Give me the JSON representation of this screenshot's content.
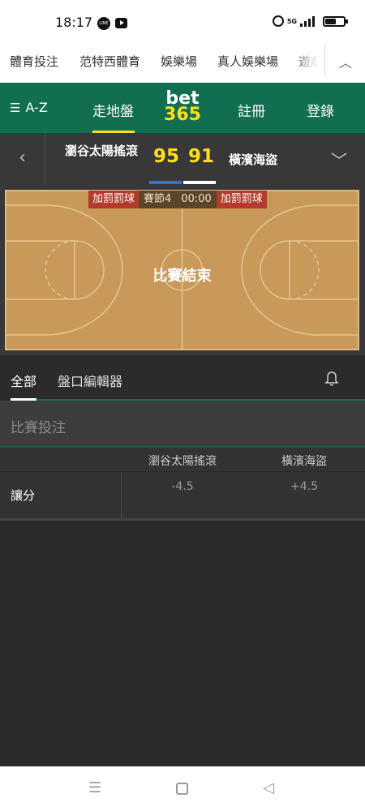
{
  "status_bar": {
    "time": "18:17",
    "network": "5G"
  },
  "top_nav": {
    "items": [
      "體育投注",
      "范特西體育",
      "娛樂場",
      "真人娛樂場",
      "遊戲"
    ]
  },
  "header": {
    "az": "A-Z",
    "live": "走地盤",
    "logo_top": "bet",
    "logo_bottom": "365",
    "register": "註冊",
    "login": "登錄"
  },
  "match": {
    "home_team": "瀏谷太陽搖滾",
    "home_score": "95",
    "away_score": "91",
    "away_team": "橫濱海盜"
  },
  "court": {
    "home_foul": "加罰罰球",
    "period": "賽節4",
    "clock": "00:00",
    "away_foul": "加罰罰球",
    "status": "比賽結束"
  },
  "tabs": {
    "all": "全部",
    "editor": "盤口編輯器"
  },
  "section": {
    "title": "比賽投注"
  },
  "market": {
    "col_home": "瀏谷太陽搖滾",
    "col_away": "橫濱海盜",
    "row_label": "讓分",
    "home_odds": "-4.5",
    "away_odds": "+4.5"
  },
  "colors": {
    "brand_green": "#126e51",
    "brand_yellow": "#ffdf1b",
    "court": "#c9995a"
  }
}
